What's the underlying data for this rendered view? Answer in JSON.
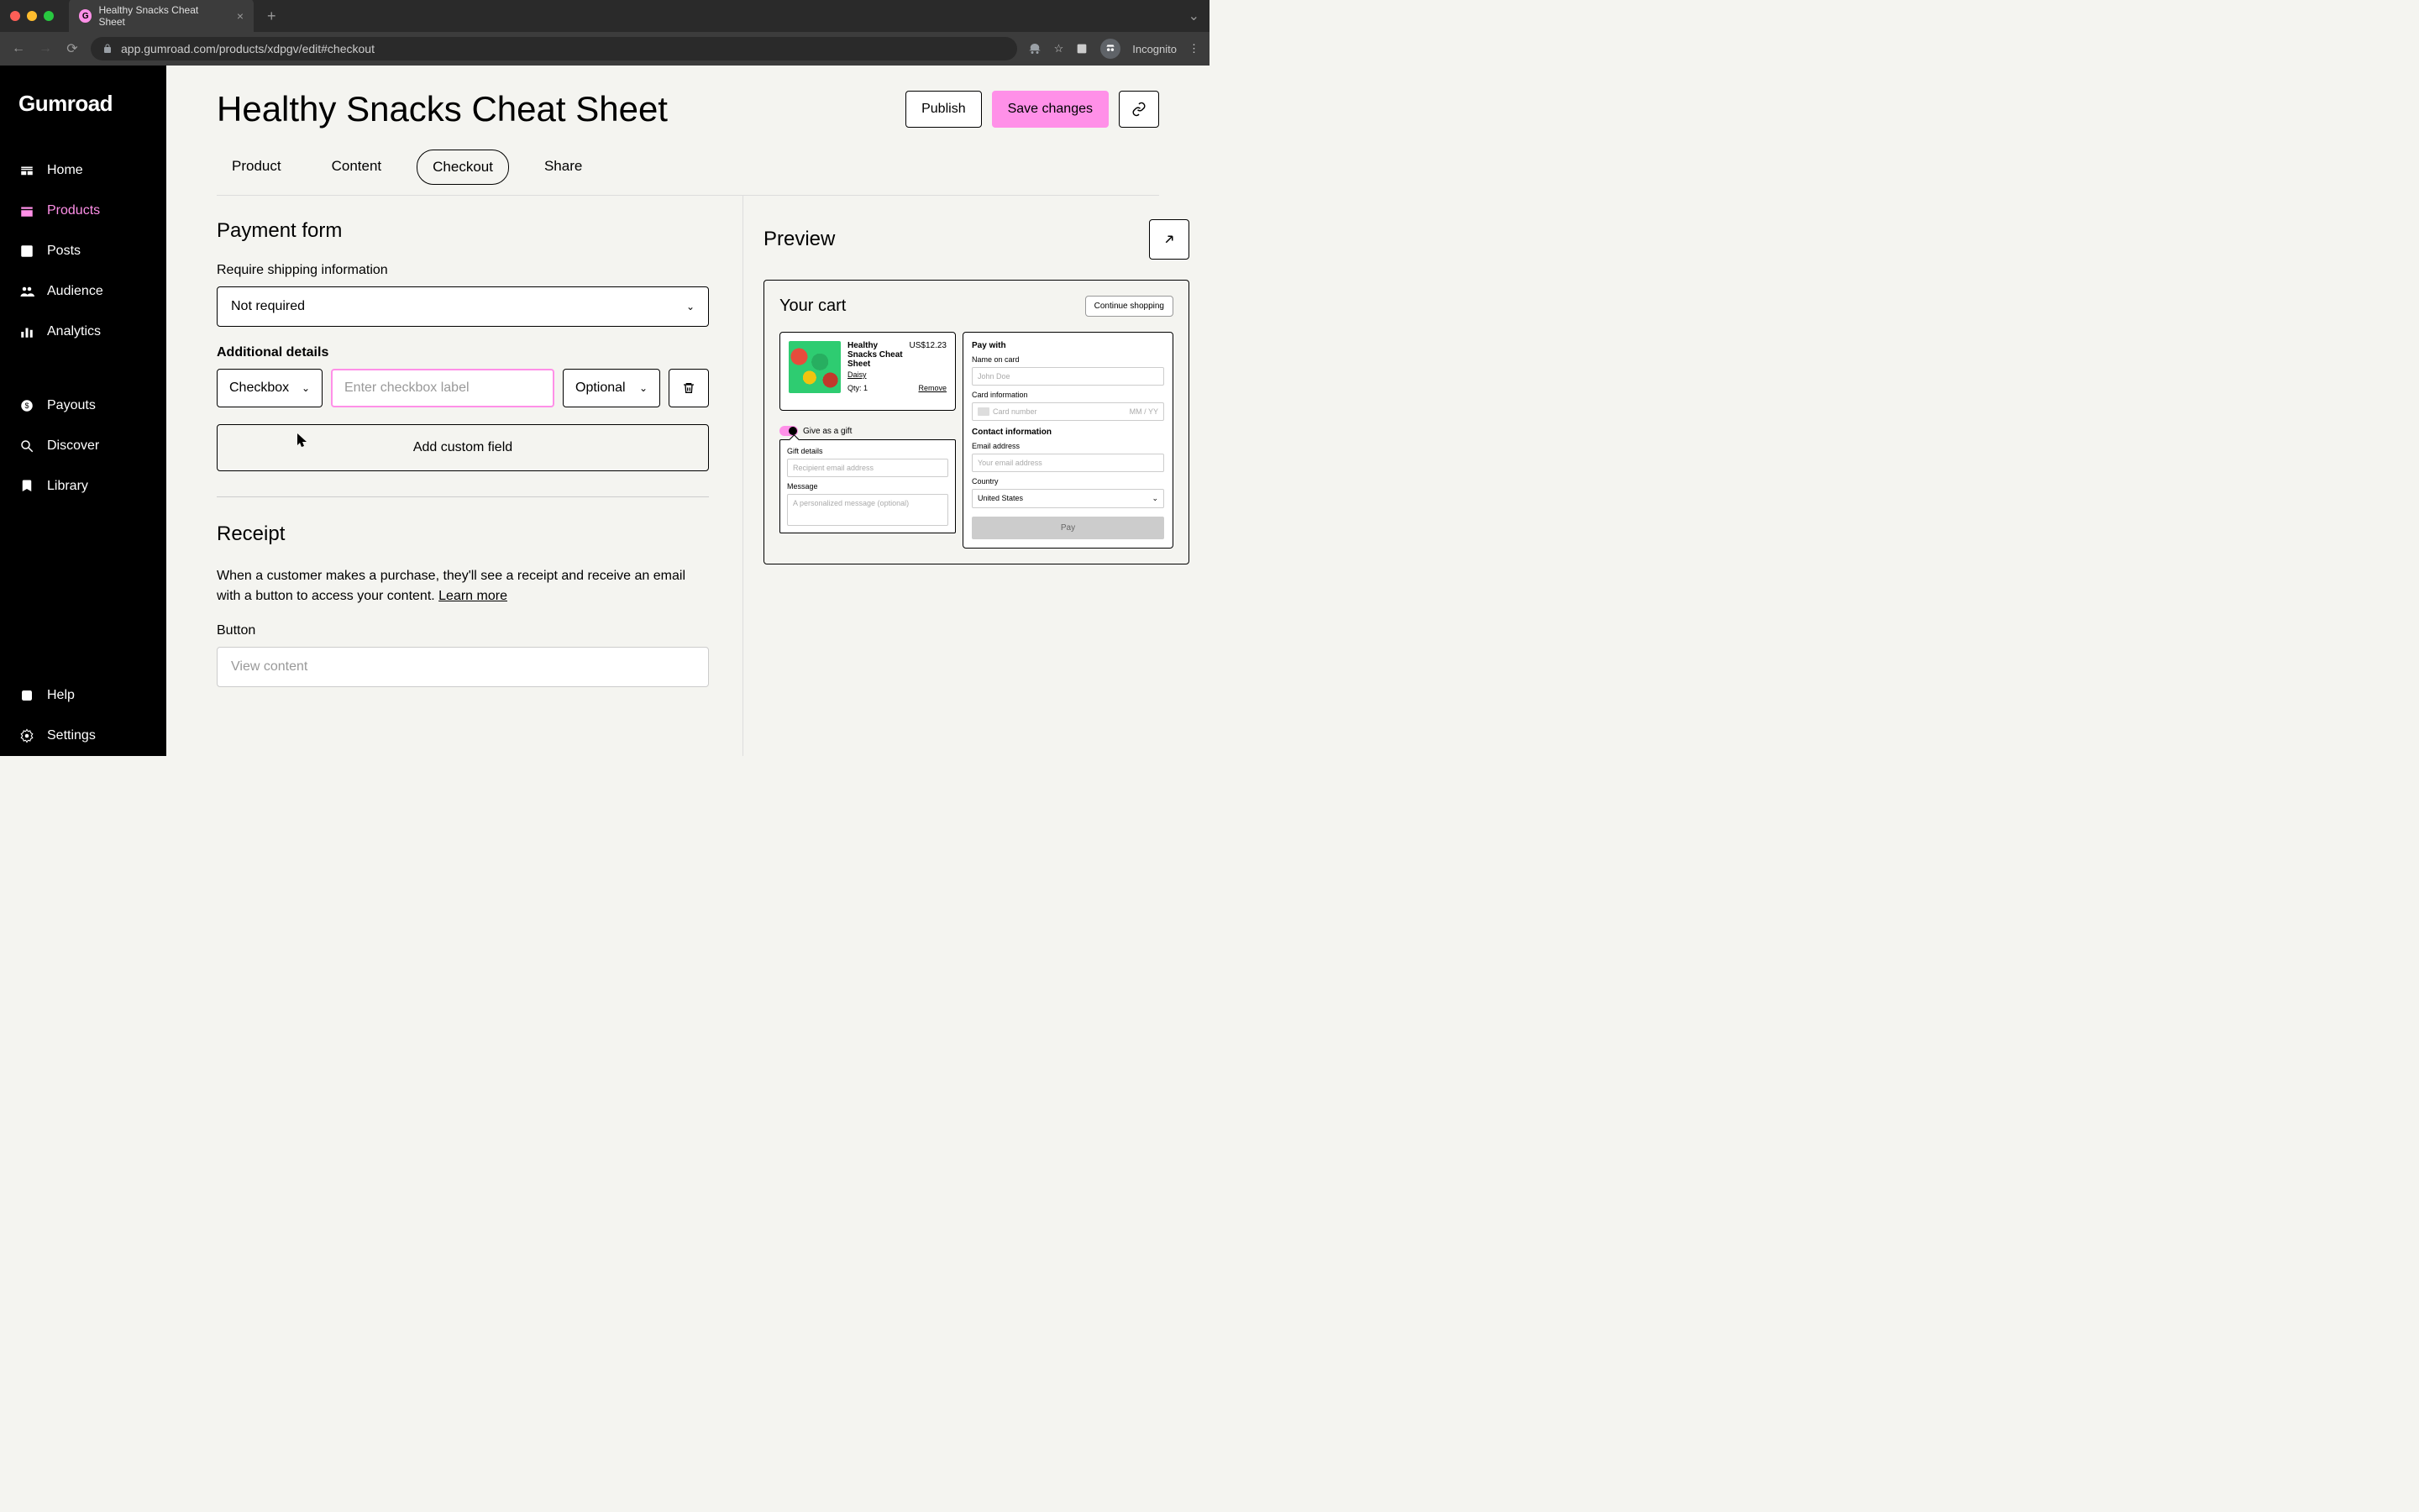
{
  "browser": {
    "tab_title": "Healthy Snacks Cheat Sheet",
    "url": "app.gumroad.com/products/xdpgv/edit#checkout",
    "incognito": "Incognito"
  },
  "sidebar": {
    "logo": "Gumroad",
    "items": [
      {
        "label": "Home"
      },
      {
        "label": "Products"
      },
      {
        "label": "Posts"
      },
      {
        "label": "Audience"
      },
      {
        "label": "Analytics"
      },
      {
        "label": "Payouts"
      },
      {
        "label": "Discover"
      },
      {
        "label": "Library"
      },
      {
        "label": "Help"
      },
      {
        "label": "Settings"
      }
    ]
  },
  "header": {
    "title": "Healthy Snacks Cheat Sheet",
    "publish": "Publish",
    "save": "Save changes"
  },
  "tabs": {
    "product": "Product",
    "content": "Content",
    "checkout": "Checkout",
    "share": "Share"
  },
  "form": {
    "payment_form_title": "Payment form",
    "shipping_label": "Require shipping information",
    "shipping_value": "Not required",
    "additional_details_label": "Additional details",
    "type_value": "Checkbox",
    "label_placeholder": "Enter checkbox label",
    "required_value": "Optional",
    "add_custom_field": "Add custom field",
    "receipt_title": "Receipt",
    "receipt_desc": "When a customer makes a purchase, they'll see a receipt and receive an email with a button to access your content. ",
    "learn_more": "Learn more",
    "button_label": "Button",
    "button_value": "View content"
  },
  "preview": {
    "title": "Preview",
    "cart_title": "Your cart",
    "continue_shopping": "Continue shopping",
    "item": {
      "name": "Healthy Snacks Cheat Sheet",
      "seller": "Daisy",
      "price": "US$12.23",
      "qty_label": "Qty:",
      "qty": "1",
      "remove": "Remove"
    },
    "gift": {
      "toggle_label": "Give as a gift",
      "details_label": "Gift details",
      "recipient_placeholder": "Recipient email address",
      "message_label": "Message",
      "message_placeholder": "A personalized message (optional)"
    },
    "payment": {
      "pay_with": "Pay with",
      "name_label": "Name on card",
      "name_placeholder": "John Doe",
      "card_info_label": "Card information",
      "card_placeholder": "Card number",
      "expiry_placeholder": "MM / YY",
      "contact_label": "Contact information",
      "email_label": "Email address",
      "email_placeholder": "Your email address",
      "country_label": "Country",
      "country_value": "United States",
      "pay_button": "Pay"
    }
  }
}
